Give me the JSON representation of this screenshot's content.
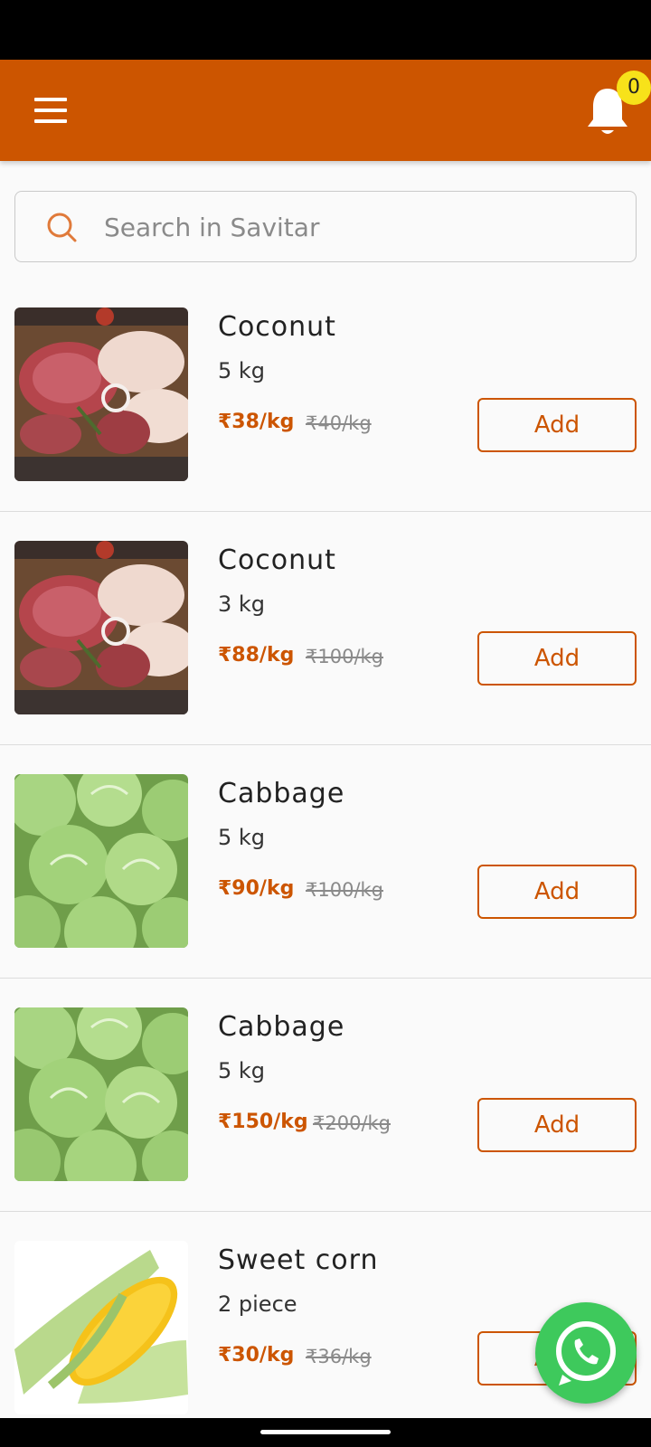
{
  "app_bar": {
    "menu_icon": "hamburger-menu-icon",
    "notification_icon": "bell-icon",
    "notification_count": "0",
    "accent_color": "#cc5500"
  },
  "search": {
    "icon": "search-icon",
    "placeholder": "Search in Savitar",
    "value": ""
  },
  "products": [
    {
      "name": "Coconut",
      "quantity": "5 kg",
      "price": "₹38/kg",
      "mrp": "₹40/kg",
      "add_label": "Add",
      "image": "meat-platter"
    },
    {
      "name": "Coconut",
      "quantity": "3 kg",
      "price": "₹88/kg",
      "mrp": "₹100/kg",
      "add_label": "Add",
      "image": "meat-platter"
    },
    {
      "name": "Cabbage",
      "quantity": "5 kg",
      "price": "₹90/kg",
      "mrp": "₹100/kg",
      "add_label": "Add",
      "image": "cabbage-pile"
    },
    {
      "name": "Cabbage",
      "quantity": "5 kg",
      "price": "₹150/kg",
      "mrp": "₹200/kg",
      "add_label": "Add",
      "image": "cabbage-pile"
    },
    {
      "name": "Sweet corn",
      "quantity": "2 piece",
      "price": "₹30/kg",
      "mrp": "₹36/kg",
      "add_label": "Add",
      "image": "sweet-corn"
    }
  ],
  "whatsapp_fab": {
    "icon": "whatsapp-icon",
    "color": "#3ec95c"
  }
}
